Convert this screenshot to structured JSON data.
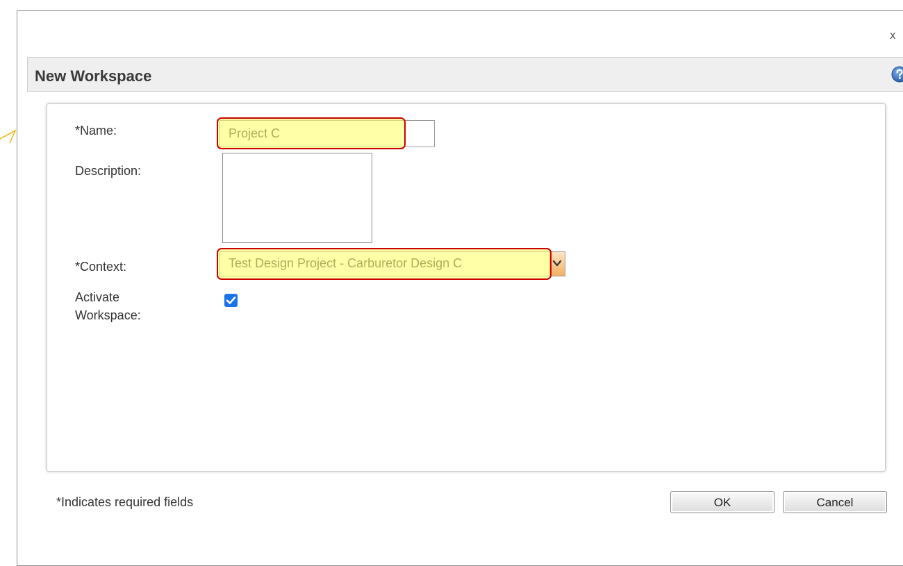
{
  "dialog": {
    "close_label": "x",
    "title": "New Workspace",
    "help_icon": "help-icon"
  },
  "form": {
    "name_label": "*Name:",
    "name_value": "Project C",
    "description_label": "Description:",
    "description_value": "",
    "context_label": "*Context:",
    "context_value": "Test Design Project - Carburetor Design C",
    "activate_label_line1": "Activate",
    "activate_label_line2": "Workspace:",
    "activate_checked": true
  },
  "footer": {
    "required_note": "*Indicates required fields",
    "ok_label": "OK",
    "cancel_label": "Cancel"
  },
  "colors": {
    "highlight_fill": "#ffff6e",
    "highlight_border": "#cc0000",
    "checkbox": "#1a73e8",
    "help_icon": "#2f6db5",
    "dropdown_arrow": "#f3b061"
  }
}
